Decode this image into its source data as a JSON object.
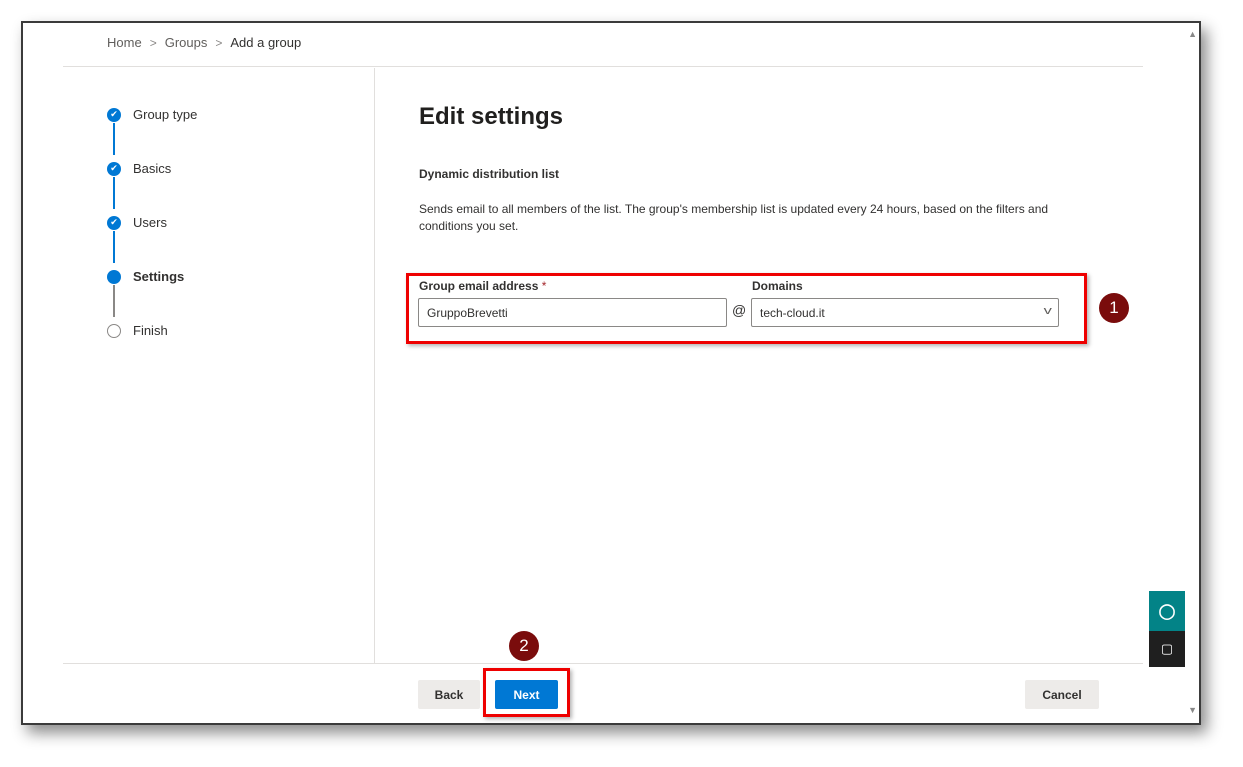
{
  "breadcrumb": {
    "items": [
      "Home",
      "Groups",
      "Add a group"
    ]
  },
  "steps": [
    {
      "label": "Group type",
      "state": "done"
    },
    {
      "label": "Basics",
      "state": "done"
    },
    {
      "label": "Users",
      "state": "done"
    },
    {
      "label": "Settings",
      "state": "current"
    },
    {
      "label": "Finish",
      "state": "todo"
    }
  ],
  "main": {
    "title": "Edit settings",
    "subtitle": "Dynamic distribution list",
    "description": "Sends email to all members of the list. The group's membership list is updated every 24 hours, based on the filters and conditions you set.",
    "email_label": "Group email address",
    "required_mark": "*",
    "email_value": "GruppoBrevetti",
    "at": "@",
    "domains_label": "Domains",
    "domain_value": "tech-cloud.it"
  },
  "footer": {
    "back": "Back",
    "next": "Next",
    "cancel": "Cancel"
  },
  "annotations": [
    "1",
    "2"
  ],
  "colors": {
    "accent": "#0078d4",
    "highlight": "#e00000",
    "badge": "#7a0c0c"
  }
}
